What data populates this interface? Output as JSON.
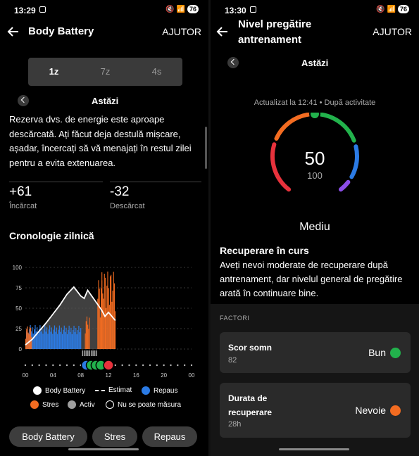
{
  "colors": {
    "green": "#22b24c",
    "orange": "#f36c21",
    "blue": "#2b7be5",
    "red": "#e8323c",
    "purple": "#8b4de8",
    "gray": "#9e9e9e"
  },
  "left": {
    "status": {
      "time": "13:29",
      "battery": "76"
    },
    "appbar": {
      "title": "Body Battery",
      "help": "AJUTOR"
    },
    "range_tabs": [
      "1z",
      "7z",
      "4s"
    ],
    "day_label": "Astăzi",
    "description": "Rezerva dvs. de energie este aproape descărcată. Ați făcut deja destulă mișcare, așadar, încercați să vă menajați în restul zilei pentru a evita extenuarea.",
    "charged": {
      "value": "+61",
      "label": "Încărcat"
    },
    "drained": {
      "value": "-32",
      "label": "Descărcat"
    },
    "timeline_title": "Cronologie zilnică",
    "legend": {
      "body_battery": "Body Battery",
      "estimated": "Estimat",
      "rest": "Repaus",
      "stress": "Stres",
      "active": "Activ",
      "unmeasurable": "Nu se poate măsura"
    },
    "buttons": {
      "body_battery": "Body Battery",
      "stress": "Stres",
      "rest": "Repaus"
    }
  },
  "right": {
    "status": {
      "time": "13:30",
      "battery": "76"
    },
    "appbar": {
      "title": "Nivel pregătire antrenament",
      "help": "AJUTOR"
    },
    "day_label": "Astăzi",
    "updated": "Actualizat la 12:41 • După activitate",
    "gauge": {
      "value": "50",
      "max": "100",
      "level": 0.5
    },
    "level_label": "Mediu",
    "recovery_title": "Recuperare în curs",
    "recovery_text": "Aveți nevoi moderate de recuperare după antrenament, dar nivelul general de pregătire arată în continuare bine.",
    "factors_title": "FACTORI",
    "factors": [
      {
        "title": "Scor somn",
        "sub": "82",
        "value": "Bun",
        "color": "#22b24c"
      },
      {
        "title": "Durata de recuperare",
        "sub": "28h",
        "value": "Nevoie",
        "color": "#f36c21"
      }
    ]
  },
  "chart_data": {
    "type": "area",
    "x_ticks": [
      "00",
      "04",
      "08",
      "12",
      "16",
      "20",
      "00"
    ],
    "y_ticks": [
      "100",
      "75",
      "50",
      "25",
      "0"
    ],
    "ylim": [
      0,
      100
    ],
    "xlim": [
      0,
      24
    ],
    "series": [
      {
        "name": "Body Battery",
        "x": [
          0,
          1,
          2,
          3,
          4,
          5,
          6,
          7,
          8,
          8.5,
          9,
          10,
          11,
          11.5,
          12,
          13
        ],
        "values": [
          5,
          12,
          22,
          32,
          43,
          54,
          67,
          76,
          65,
          62,
          72,
          60,
          48,
          40,
          45,
          35
        ]
      }
    ]
  }
}
